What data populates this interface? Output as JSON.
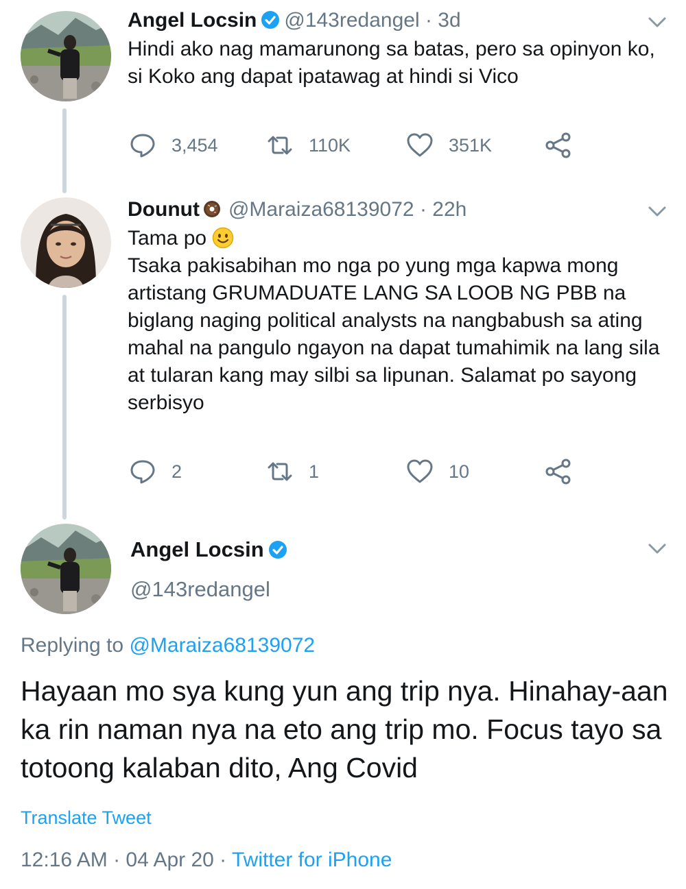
{
  "tweet1": {
    "name": "Angel Locsin",
    "handle": "@143redangel",
    "time": "· 3d",
    "text": "Hindi ako nag mamarunong sa batas, pero sa opinyon ko, si Koko ang dapat ipatawag at hindi si Vico",
    "replies": "3,454",
    "retweets": "110K",
    "likes": "351K"
  },
  "tweet2": {
    "name": "Dounut",
    "handle": "@Maraiza68139072",
    "time": "· 22h",
    "line1": "Tama po",
    "line2": "Tsaka pakisabihan mo nga po yung mga kapwa mong artistang GRUMADUATE LANG SA LOOB NG PBB na biglang naging political analysts na nangbabush sa ating mahal na pangulo ngayon na dapat tumahimik na lang sila at tularan kang may silbi sa lipunan. Salamat po sayong serbisyo",
    "replies": "2",
    "retweets": "1",
    "likes": "10"
  },
  "main": {
    "name": "Angel Locsin",
    "handle": "@143redangel",
    "replying_label": "Replying to",
    "replying_to": "@Maraiza68139072",
    "text": "Hayaan mo sya kung yun ang trip nya. Hinahay-aan ka rin naman nya na eto ang trip mo. Focus tayo sa totoong kalaban dito, Ang Covid",
    "translate": "Translate Tweet",
    "timestamp": "12:16 AM · 04 Apr 20 ·",
    "source": "Twitter for iPhone"
  },
  "colors": {
    "accent": "#1da1f2",
    "secondary_text": "#657786",
    "thread_line": "#ccd6dd"
  },
  "icons": [
    "verified-badge-icon",
    "chevron-down-icon",
    "reply-icon",
    "retweet-icon",
    "like-icon",
    "share-icon",
    "smiley-emoji-icon",
    "donut-badge-icon"
  ]
}
